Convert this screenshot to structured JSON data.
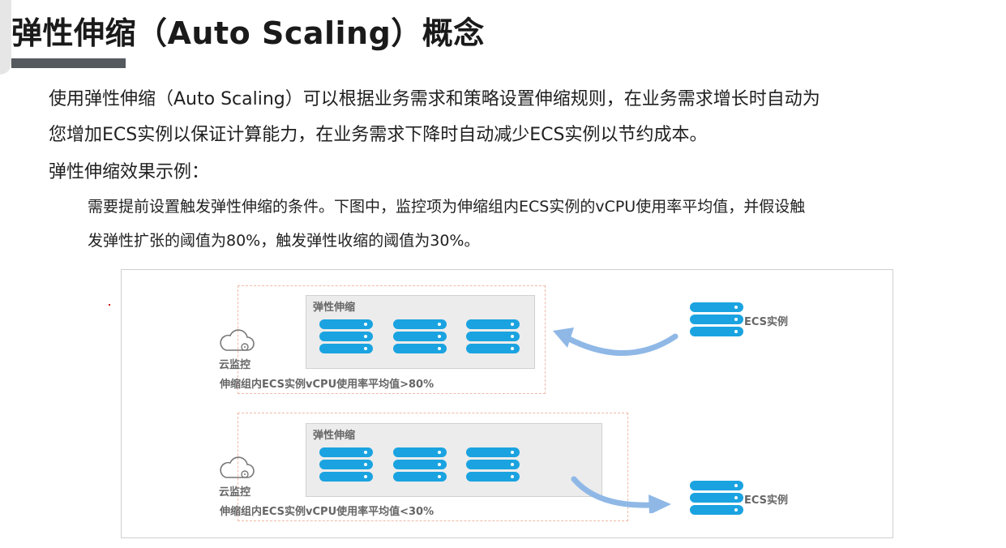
{
  "slide": {
    "title": "弹性伸缩（Auto Scaling）概念",
    "paragraph_line1": "使用弹性伸缩（Auto Scaling）可以根据业务需求和策略设置伸缩规则，在业务需求增长时自动为",
    "paragraph_line2": "您增加ECS实例以保证计算能力，在业务需求下降时自动减少ECS实例以节约成本。",
    "example_heading": "弹性伸缩效果示例：",
    "detail_line1": "需要提前设置触发弹性伸缩的条件。下图中，监控项为伸缩组内ECS实例的vCPU使用率平均值，并假设触",
    "detail_line2": "发弹性扩张的阈值为80%，触发弹性收缩的阈值为30%。"
  },
  "figure": {
    "scale_out": {
      "group_label": "弹性伸缩",
      "monitor_label": "云监控",
      "condition": "伸缩组内ECS实例vCPU使用率平均值>80%",
      "ecs_label": "ECS实例",
      "servers_in_group": 3,
      "direction": "into-group"
    },
    "scale_in": {
      "group_label": "弹性伸缩",
      "monitor_label": "云监控",
      "condition": "伸缩组内ECS实例vCPU使用率平均值<30%",
      "ecs_label": "ECS实例",
      "servers_in_group": 3,
      "direction": "out-of-group"
    },
    "colors": {
      "server": "#1aa3e0",
      "arrow": "#8fb8e6",
      "group_border": "#f0b9a8",
      "title_bar": "#555a5f"
    }
  }
}
